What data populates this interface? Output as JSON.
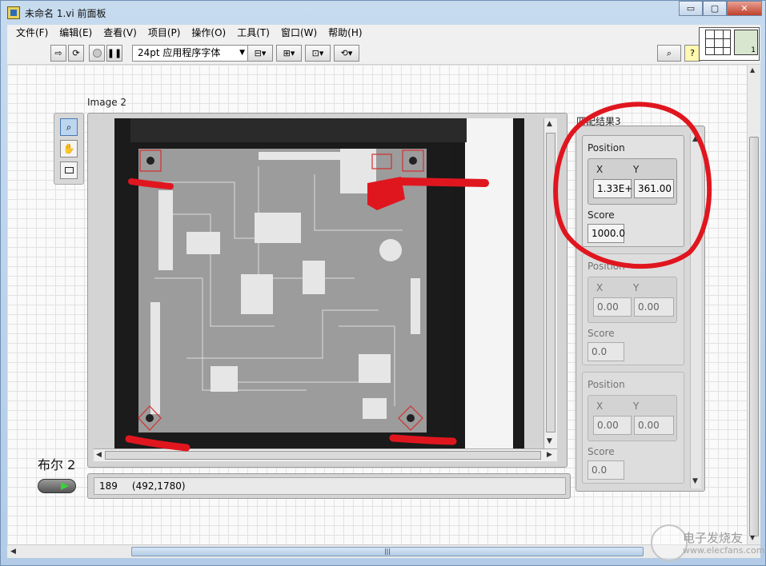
{
  "window": {
    "title": "未命名 1.vi 前面板",
    "controls": {
      "minimize": "▭",
      "maximize": "▢",
      "close": "✕"
    }
  },
  "menu": [
    "文件(F)",
    "编辑(E)",
    "查看(V)",
    "项目(P)",
    "操作(O)",
    "工具(T)",
    "窗口(W)",
    "帮助(H)"
  ],
  "toolbar": {
    "font": "24pt 应用程序字体",
    "vi_icon_number": "1"
  },
  "image_display": {
    "label": "Image 2",
    "status_pixel_value": "189",
    "status_coords": "(492,1780)"
  },
  "boolean": {
    "label": "布尔 2"
  },
  "matches": {
    "label": "匹配结果3",
    "clusters": [
      {
        "position_label": "Position",
        "x_label": "X",
        "y_label": "Y",
        "x": "1.33E+",
        "y": "361.00",
        "score_label": "Score",
        "score": "1000.0"
      },
      {
        "position_label": "Position",
        "x_label": "X",
        "y_label": "Y",
        "x": "0.00",
        "y": "0.00",
        "score_label": "Score",
        "score": "0.0"
      },
      {
        "position_label": "Position",
        "x_label": "X",
        "y_label": "Y",
        "x": "0.00",
        "y": "0.00",
        "score_label": "Score",
        "score": "0.0"
      }
    ]
  },
  "colors": {
    "annotation_red": "#e0161f",
    "match_box_red": "#d33030"
  },
  "watermark": {
    "text": "电子发烧友",
    "url": "www.elecfans.com"
  }
}
